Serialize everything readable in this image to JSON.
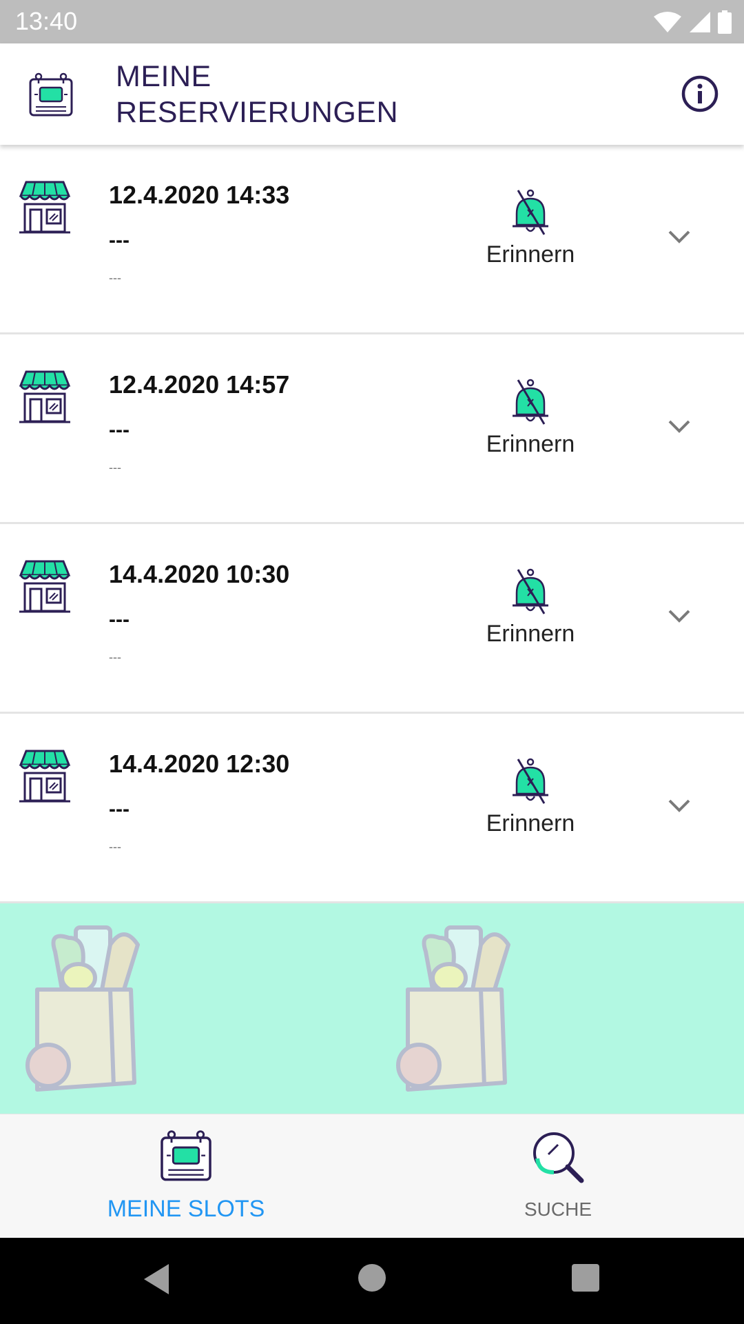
{
  "status_bar": {
    "time": "13:40",
    "icons": [
      "wifi-icon",
      "signal-icon",
      "battery-icon"
    ]
  },
  "app_bar": {
    "title": "MEINE RESERVIERUNGEN",
    "logo_icon": "calendar-screen-icon",
    "info_icon": "info-icon"
  },
  "reservations": [
    {
      "date": "12.4.2020 14:33",
      "line1": "---",
      "line2": "---",
      "remind_label": "Erinnern"
    },
    {
      "date": "12.4.2020 14:57",
      "line1": "---",
      "line2": "---",
      "remind_label": "Erinnern"
    },
    {
      "date": "14.4.2020 10:30",
      "line1": "---",
      "line2": "---",
      "remind_label": "Erinnern"
    },
    {
      "date": "14.4.2020 12:30",
      "line1": "---",
      "line2": "---",
      "remind_label": "Erinnern"
    }
  ],
  "bottom_nav": {
    "tabs": [
      {
        "label": "MEINE SLOTS",
        "icon": "calendar-screen-icon",
        "active": true
      },
      {
        "label": "SUCHE",
        "icon": "magnifier-icon",
        "active": false
      }
    ]
  },
  "colors": {
    "accent": "#2196f3",
    "mint": "#b2f8e2",
    "brand_green": "#23e0a5",
    "dark_purple": "#2c1f55"
  }
}
